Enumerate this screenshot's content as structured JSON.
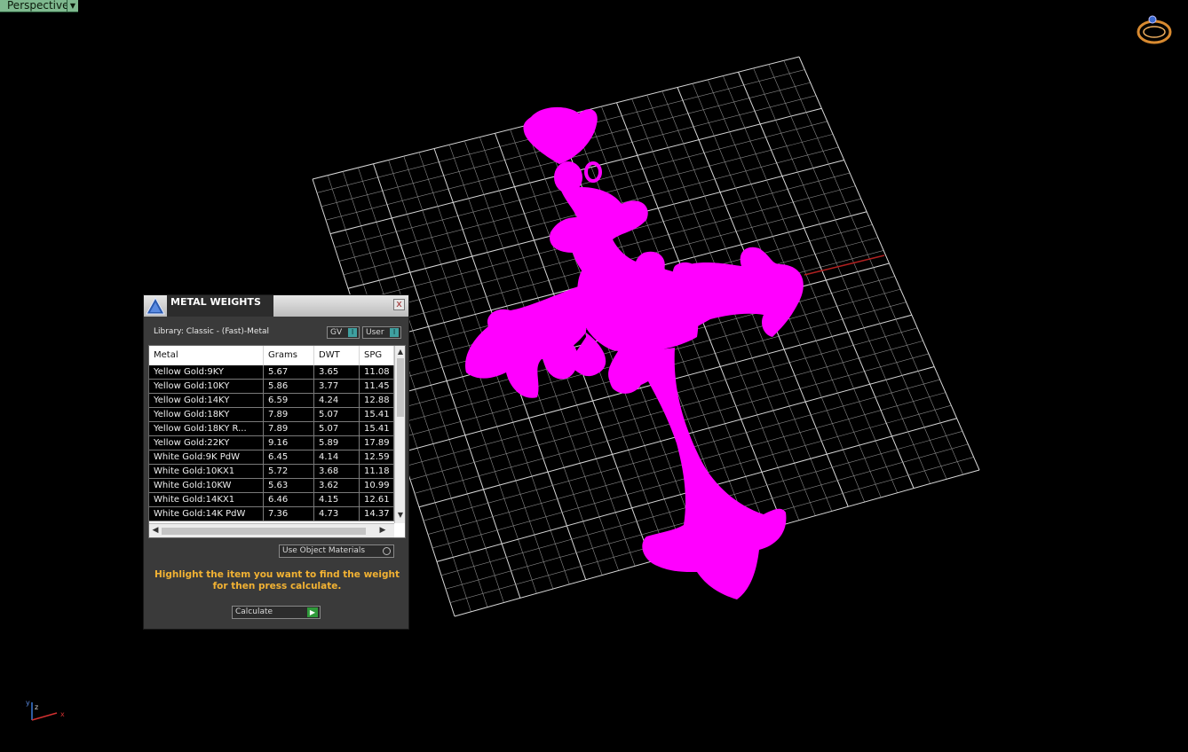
{
  "viewport": {
    "view_name": "Perspective",
    "axes": {
      "x": "x",
      "y": "y",
      "z": "z"
    }
  },
  "panel": {
    "title": "METAL WEIGHTS",
    "close_glyph": "x",
    "library_label": "Library: Classic - (Fast)-Metal",
    "toggles": {
      "gv": "GV",
      "user": "User",
      "indicator": "I"
    },
    "columns": [
      "Metal",
      "Grams",
      "DWT",
      "SPG"
    ],
    "rows": [
      {
        "metal": "Yellow Gold:9KY",
        "grams": "5.67",
        "dwt": "3.65",
        "spg": "11.08"
      },
      {
        "metal": "Yellow Gold:10KY",
        "grams": "5.86",
        "dwt": "3.77",
        "spg": "11.45"
      },
      {
        "metal": "Yellow Gold:14KY",
        "grams": "6.59",
        "dwt": "4.24",
        "spg": "12.88"
      },
      {
        "metal": "Yellow Gold:18KY",
        "grams": "7.89",
        "dwt": "5.07",
        "spg": "15.41"
      },
      {
        "metal": "Yellow Gold:18KY R...",
        "grams": "7.89",
        "dwt": "5.07",
        "spg": "15.41"
      },
      {
        "metal": "Yellow Gold:22KY",
        "grams": "9.16",
        "dwt": "5.89",
        "spg": "17.89"
      },
      {
        "metal": "White Gold:9K PdW",
        "grams": "6.45",
        "dwt": "4.14",
        "spg": "12.59"
      },
      {
        "metal": "White Gold:10KX1",
        "grams": "5.72",
        "dwt": "3.68",
        "spg": "11.18"
      },
      {
        "metal": "White Gold:10KW",
        "grams": "5.63",
        "dwt": "3.62",
        "spg": "10.99"
      },
      {
        "metal": "White Gold:14KX1",
        "grams": "6.46",
        "dwt": "4.15",
        "spg": "12.61"
      },
      {
        "metal": "White Gold:14K PdW",
        "grams": "7.36",
        "dwt": "4.73",
        "spg": "14.37"
      }
    ],
    "use_object_materials_label": "Use Object Materials",
    "hint": "Highlight the item you want to find the weight for then press calculate.",
    "calculate_label": "Calculate",
    "colors": {
      "hint": "#f2b233",
      "object": "#ff00ff",
      "grid": "#c8c8c8",
      "x_axis": "#b02020"
    }
  }
}
